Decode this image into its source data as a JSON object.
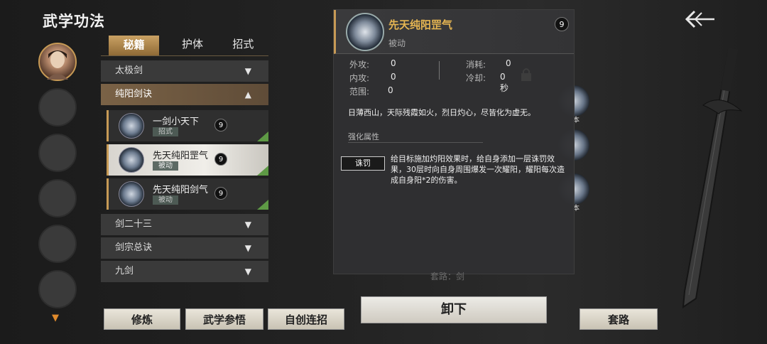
{
  "header": {
    "title": "武学功法",
    "back_icon": "back-arrow-icon"
  },
  "tabs": [
    {
      "label": "秘籍",
      "active": true
    },
    {
      "label": "护体",
      "active": false
    },
    {
      "label": "招式",
      "active": false
    }
  ],
  "categories": {
    "c1": "太极剑",
    "c2": "纯阳剑诀",
    "c3": "剑二十三",
    "c4": "剑宗总诀",
    "c5": "九剑"
  },
  "skills": [
    {
      "name": "一剑小天下",
      "tag": "招式",
      "level": "9"
    },
    {
      "name": "先天纯阳罡气",
      "tag": "被动",
      "level": "9"
    },
    {
      "name": "先天纯阳剑气",
      "tag": "被动",
      "level": "9"
    }
  ],
  "bottom_buttons": {
    "train": "修炼",
    "insight": "武学参悟",
    "custom_combo": "自创连招",
    "unequip": "卸下",
    "routine": "套路"
  },
  "detail": {
    "name": "先天纯阳罡气",
    "type": "被动",
    "level": "9",
    "stats": {
      "outer_label": "外攻:",
      "outer_value": "0",
      "inner_label": "内攻:",
      "inner_value": "0",
      "range_label": "范围:",
      "range_value": "0",
      "cost_label": "消耗:",
      "cost_value": "0",
      "cooldown_label": "冷却:",
      "cooldown_value": "0秒"
    },
    "description": "日薄西山，天际残霞如火，烈日灼心，尽皆化为虚无。",
    "enhance_header": "强化属性",
    "trait_tag": "诛罚",
    "trait_desc": "给目标施加灼阳效果时，给自身添加一层诛罚效果，30层时向自身周围爆发一次耀阳，耀阳每次造成自身阳*2的伤害。",
    "faint_routine": "套路：剑"
  },
  "side_labels": {
    "a": "本",
    "b": "本"
  },
  "colors": {
    "accent": "#c79a55",
    "name_gold": "#e5b552",
    "check_green": "#5e9a45"
  }
}
